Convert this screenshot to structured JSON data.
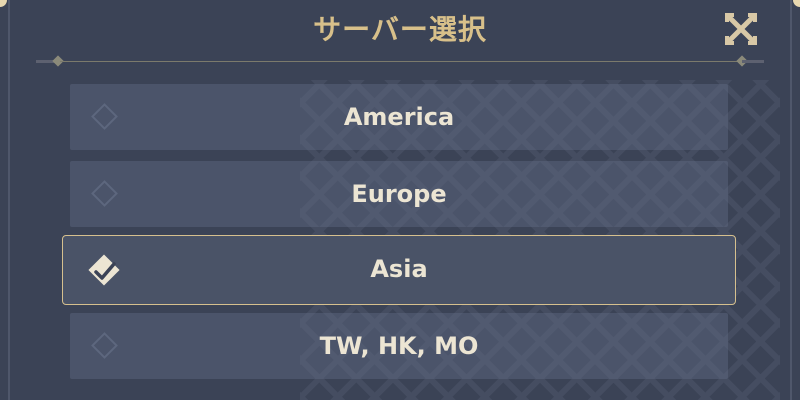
{
  "dialog": {
    "title": "サーバー選択",
    "close_icon": "close-x-icon"
  },
  "servers": [
    {
      "label": "America",
      "selected": false,
      "icon": "diamond-outline-icon"
    },
    {
      "label": "Europe",
      "selected": false,
      "icon": "diamond-outline-icon"
    },
    {
      "label": "Asia",
      "selected": true,
      "icon": "diamond-check-icon"
    },
    {
      "label": "TW, HK, MO",
      "selected": false,
      "icon": "diamond-outline-icon"
    }
  ],
  "colors": {
    "background": "#3b4356",
    "title": "#d8c08a",
    "selected_border": "#d6c08e",
    "label": "#ece5d3"
  }
}
